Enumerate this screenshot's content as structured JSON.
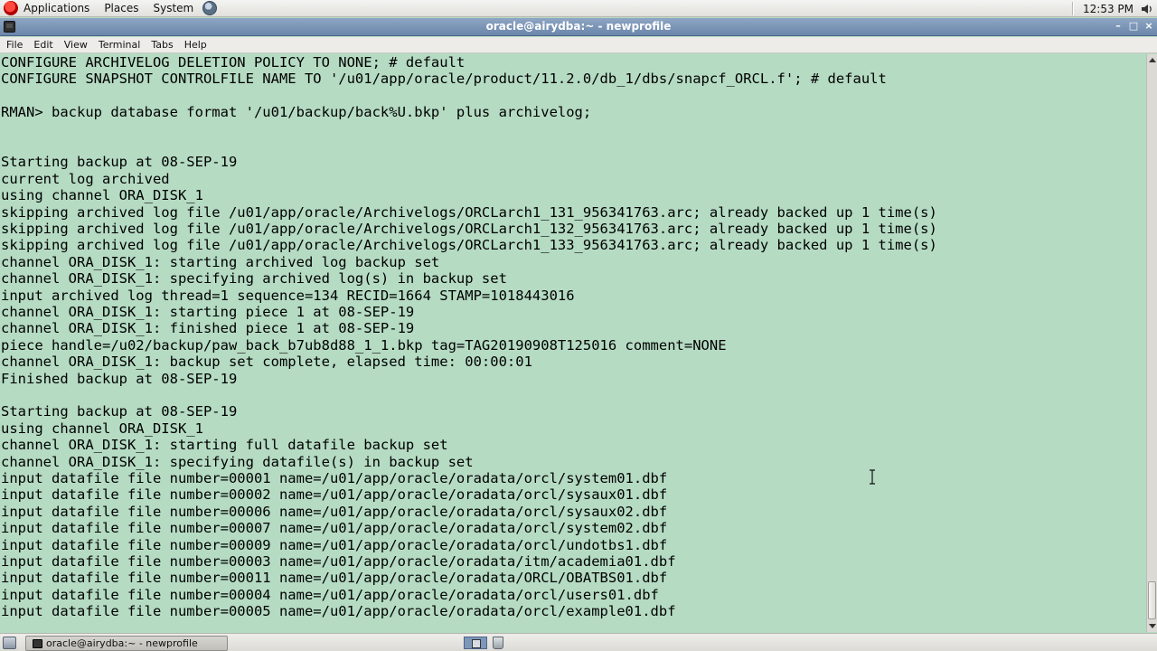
{
  "top_panel": {
    "menus": [
      "Applications",
      "Places",
      "System"
    ],
    "clock": "12:53 PM"
  },
  "window": {
    "title": "oracle@airydba:~ - newprofile",
    "controls": [
      "–",
      "□",
      "×"
    ]
  },
  "menubar": {
    "items": [
      "File",
      "Edit",
      "View",
      "Terminal",
      "Tabs",
      "Help"
    ]
  },
  "terminal": {
    "lines": [
      "CONFIGURE ARCHIVELOG DELETION POLICY TO NONE; # default",
      "CONFIGURE SNAPSHOT CONTROLFILE NAME TO '/u01/app/oracle/product/11.2.0/db_1/dbs/snapcf_ORCL.f'; # default",
      "",
      "RMAN> backup database format '/u01/backup/back%U.bkp' plus archivelog;",
      "",
      "",
      "Starting backup at 08-SEP-19",
      "current log archived",
      "using channel ORA_DISK_1",
      "skipping archived log file /u01/app/oracle/Archivelogs/ORCLarch1_131_956341763.arc; already backed up 1 time(s)",
      "skipping archived log file /u01/app/oracle/Archivelogs/ORCLarch1_132_956341763.arc; already backed up 1 time(s)",
      "skipping archived log file /u01/app/oracle/Archivelogs/ORCLarch1_133_956341763.arc; already backed up 1 time(s)",
      "channel ORA_DISK_1: starting archived log backup set",
      "channel ORA_DISK_1: specifying archived log(s) in backup set",
      "input archived log thread=1 sequence=134 RECID=1664 STAMP=1018443016",
      "channel ORA_DISK_1: starting piece 1 at 08-SEP-19",
      "channel ORA_DISK_1: finished piece 1 at 08-SEP-19",
      "piece handle=/u02/backup/paw_back_b7ub8d88_1_1.bkp tag=TAG20190908T125016 comment=NONE",
      "channel ORA_DISK_1: backup set complete, elapsed time: 00:00:01",
      "Finished backup at 08-SEP-19",
      "",
      "Starting backup at 08-SEP-19",
      "using channel ORA_DISK_1",
      "channel ORA_DISK_1: starting full datafile backup set",
      "channel ORA_DISK_1: specifying datafile(s) in backup set",
      "input datafile file number=00001 name=/u01/app/oracle/oradata/orcl/system01.dbf",
      "input datafile file number=00002 name=/u01/app/oracle/oradata/orcl/sysaux01.dbf",
      "input datafile file number=00006 name=/u01/app/oracle/oradata/orcl/sysaux02.dbf",
      "input datafile file number=00007 name=/u01/app/oracle/oradata/orcl/system02.dbf",
      "input datafile file number=00009 name=/u01/app/oracle/oradata/orcl/undotbs1.dbf",
      "input datafile file number=00003 name=/u01/app/oracle/oradata/itm/academia01.dbf",
      "input datafile file number=00011 name=/u01/app/oracle/oradata/ORCL/OBATBS01.dbf",
      "input datafile file number=00004 name=/u01/app/oracle/oradata/orcl/users01.dbf",
      "input datafile file number=00005 name=/u01/app/oracle/oradata/orcl/example01.dbf"
    ]
  },
  "taskbar": {
    "task_label": "oracle@airydba:~ - newprofile"
  },
  "colors": {
    "terminal_bg": "#b5dbc3",
    "titlebar": "#7a93b6"
  }
}
